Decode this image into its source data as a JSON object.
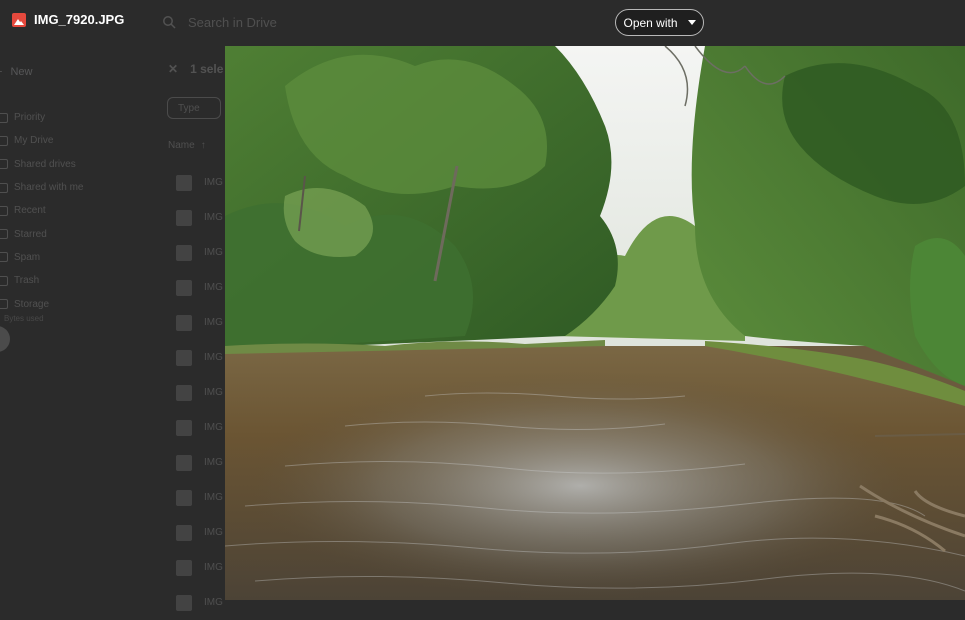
{
  "viewer": {
    "file_name": "IMG_7920.JPG",
    "file_icon": "image-file-icon",
    "open_with_label": "Open with",
    "image": {
      "description_tag": "photo",
      "colors": {
        "sky": "#eef0ee",
        "foliage": "#3f6b2c",
        "water": "#6a5633"
      }
    }
  },
  "background": {
    "search_placeholder": "Search in Drive",
    "new_label": "New",
    "nav": [
      "Priority",
      "My Drive",
      "Shared drives",
      "Shared with me",
      "Recent",
      "Starred",
      "Spam",
      "Trash",
      "Storage"
    ],
    "storage_text": "Bytes used",
    "selection_text": "1 sele",
    "type_filter": "Type",
    "column_name": "Name",
    "row_label": "IMG"
  },
  "accent_colors": {
    "topbar_bg": "#2b2b2b",
    "open_with_border": "#b8b8b8",
    "file_icon": "#e5493d"
  }
}
